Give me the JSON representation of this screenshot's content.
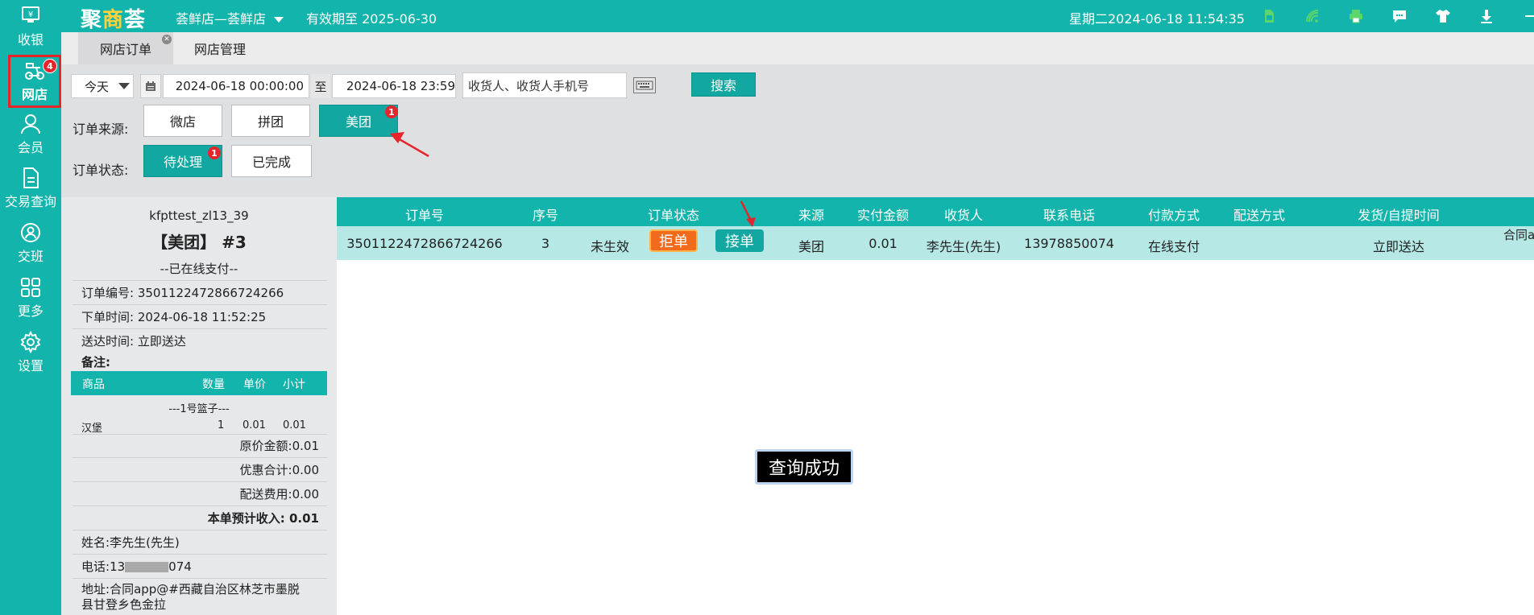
{
  "topbar": {
    "logo_part1": "聚",
    "logo_part2": "商",
    "logo_part3": "荟",
    "store": "荟鲜店—荟鲜店",
    "expire": "有效期至 2025-06-30",
    "datetime": "星期二2024-06-18 11:54:35",
    "icons": [
      "sim-card-icon",
      "wifi-icon",
      "printer-icon",
      "message-icon",
      "shirt-icon",
      "download-icon",
      "minimize-icon",
      "close-icon"
    ]
  },
  "sidebar": {
    "items": [
      {
        "label": "收银",
        "icon": "cashier-icon"
      },
      {
        "label": "网店",
        "icon": "scooter-icon",
        "badge": "4"
      },
      {
        "label": "会员",
        "icon": "member-icon"
      },
      {
        "label": "交易查询",
        "icon": "document-icon"
      },
      {
        "label": "交班",
        "icon": "shift-icon"
      },
      {
        "label": "更多",
        "icon": "grid-icon"
      },
      {
        "label": "设置",
        "icon": "gear-icon"
      }
    ]
  },
  "tabs": [
    {
      "label": "网店订单",
      "active": true
    },
    {
      "label": "网店管理",
      "active": false
    }
  ],
  "filters": {
    "period": "今天",
    "date_from": "2024-06-18 00:00:00",
    "to_label": "至",
    "date_to": "2024-06-18 23:59",
    "search_placeholder": "收货人、收货人手机号",
    "search_button": "搜索",
    "source_label": "订单来源:",
    "sources": [
      "微店",
      "拼团",
      "美团"
    ],
    "source_badge": "1",
    "status_label": "订单状态:",
    "statuses": [
      "待处理",
      "已完成"
    ],
    "status_badge": "1"
  },
  "receipt": {
    "store_id": "kfpttest_zl13_39",
    "platform_no": "【美团】 #3",
    "pay_status": "--已在线支付--",
    "order_no_label": "订单编号:",
    "order_no": "3501122472866724266",
    "order_time_label": "下单时间:",
    "order_time": "2024-06-18 11:52:25",
    "delivery_time_label": "送达时间:",
    "delivery_time": "立即送达",
    "remark_label": "备注:",
    "col_goods": "商品",
    "col_qty": "数量",
    "col_price": "单价",
    "col_subtotal": "小计",
    "basket": "---1号篮子---",
    "item_name": "汉堡",
    "item_qty": "1",
    "item_price": "0.01",
    "item_subtotal": "0.01",
    "original_label": "原价金额:",
    "original": "0.01",
    "discount_label": "优惠合计:",
    "discount": "0.00",
    "delivery_fee_label": "配送费用:",
    "delivery_fee": "0.00",
    "income_label": "本单预计收入:",
    "income": "0.01",
    "name_label": "姓名:",
    "name": "李先生(先生)",
    "phone_label": "电话:",
    "phone_start": "13",
    "phone_end": "074",
    "address_label": "地址:",
    "address_line1": "合同app@#西藏自治区林芝市墨脱",
    "address_line2": "县甘登乡色金拉"
  },
  "table": {
    "headers": [
      "订单号",
      "序号",
      "订单状态",
      "来源",
      "实付金额",
      "收货人",
      "联系电话",
      "付款方式",
      "配送方式",
      "发货/自提时间"
    ],
    "row": {
      "order_no": "3501122472866724266",
      "seq": "3",
      "status": "未生效",
      "reject": "拒单",
      "accept": "接单",
      "source": "美团",
      "amount": "0.01",
      "receiver": "李先生(先生)",
      "phone": "13978850074",
      "payment": "在线支付",
      "delivery": "",
      "ship_time": "立即送达",
      "overflow": "合同a"
    }
  },
  "toast": "查询成功",
  "colors": {
    "brand": "#12b4ac",
    "button_teal": "#12a7a0",
    "reject": "#f26a1b",
    "highlight": "#e5242b"
  }
}
